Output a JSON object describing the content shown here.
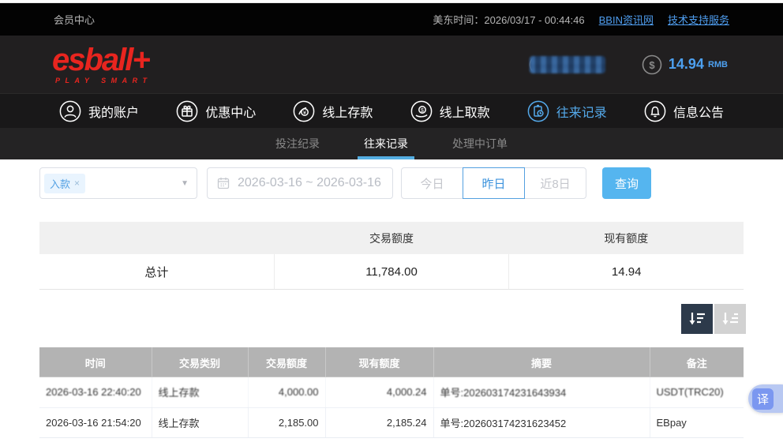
{
  "topbar": {
    "member_center": "会员中心",
    "time_label": "美东时间：2026/03/17 - 00:44:46",
    "link_news": "BBIN资讯网",
    "link_support": "技术支持服务"
  },
  "header": {
    "logo_main": "esball+",
    "logo_sub": "PLAY SMART",
    "balance": {
      "amount": "14.94",
      "currency": "RMB"
    }
  },
  "nav": {
    "items": [
      {
        "label": "我的账户",
        "icon": "user-icon",
        "active": false
      },
      {
        "label": "优惠中心",
        "icon": "gift-icon",
        "active": false
      },
      {
        "label": "线上存款",
        "icon": "deposit-icon",
        "active": false
      },
      {
        "label": "线上取款",
        "icon": "withdraw-icon",
        "active": false
      },
      {
        "label": "往来记录",
        "icon": "records-icon",
        "active": true
      },
      {
        "label": "信息公告",
        "icon": "bell-icon",
        "active": false
      }
    ]
  },
  "subnav": {
    "tabs": [
      {
        "label": "投注纪录",
        "active": false
      },
      {
        "label": "往来记录",
        "active": true
      },
      {
        "label": "处理中订单",
        "active": false
      }
    ]
  },
  "filters": {
    "type_tag": "入款",
    "tag_close": "×",
    "date_range": "2026-03-16 ~ 2026-03-16",
    "quick_buttons": [
      {
        "label": "今日",
        "active": false
      },
      {
        "label": "昨日",
        "active": true
      },
      {
        "label": "近8日",
        "active": false
      }
    ],
    "search_label": "查询"
  },
  "summary": {
    "col_transaction": "交易额度",
    "col_current": "现有额度",
    "total_label": "总计",
    "transaction_total": "11,784.00",
    "current_total": "14.94"
  },
  "table": {
    "headers": {
      "time": "时间",
      "type": "交易类别",
      "amount": "交易额度",
      "balance": "现有额度",
      "summary": "摘要",
      "note": "备注"
    },
    "rows": [
      {
        "time": "2026-03-16 22:40:20",
        "type": "线上存款",
        "amount": "4,000.00",
        "balance": "4,000.24",
        "summary": "单号:202603174231643934",
        "note": "USDT(TRC20)"
      },
      {
        "time": "2026-03-16 21:54:20",
        "type": "线上存款",
        "amount": "2,185.00",
        "balance": "2,185.24",
        "summary": "单号:202603174231623452",
        "note": "EBpay"
      }
    ]
  },
  "floating": {
    "translate_label": "译"
  },
  "colors": {
    "accent_blue": "#54a9ea",
    "brand_red": "#e8251f",
    "search_btn": "#55b5ef",
    "table_header_gray": "#b3b3b3",
    "sort_dark": "#2d3a4b"
  }
}
